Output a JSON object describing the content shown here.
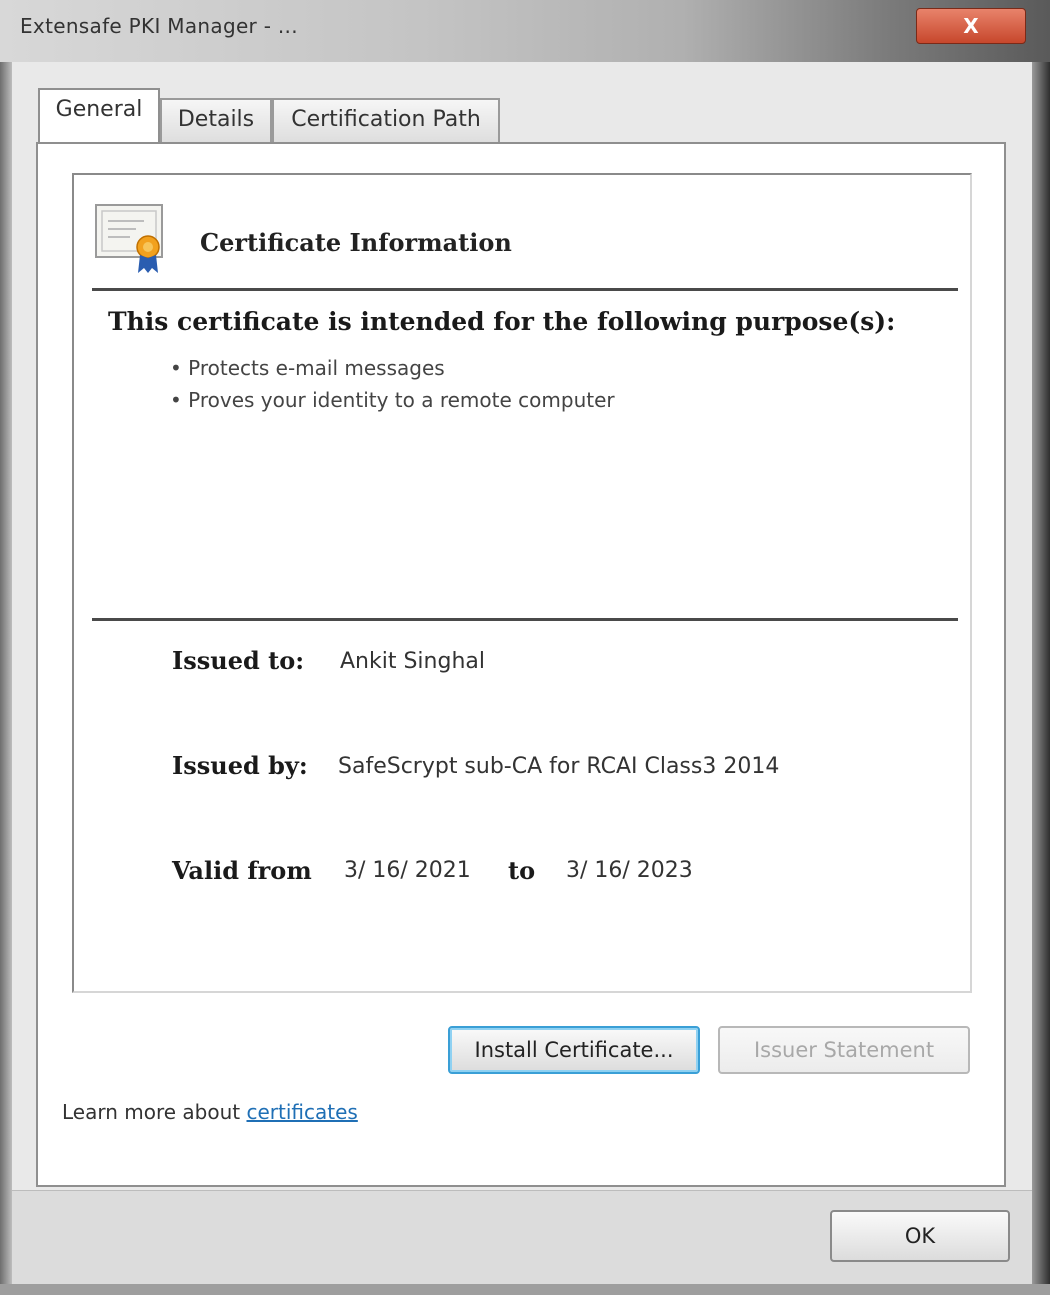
{
  "window": {
    "title": "Extensafe PKI Manager - ...",
    "close_label": "X"
  },
  "tabs": [
    {
      "label": "General",
      "active": true
    },
    {
      "label": "Details",
      "active": false
    },
    {
      "label": "Certification Path",
      "active": false
    }
  ],
  "certificate": {
    "info_title": "Certificate Information",
    "icon": "certificate-icon",
    "purpose_heading": "This certificate is intended for the following purpose(s):",
    "purposes": [
      "• Protects e-mail messages",
      "• Proves your identity to a remote computer"
    ],
    "issued_to_label": "Issued to:",
    "issued_to_value": "Ankit Singhal",
    "issued_by_label": "Issued by:",
    "issued_by_value": "SafeScrypt sub-CA for RCAI Class3 2014",
    "valid_from_label": "Valid from",
    "valid_from_value": "3/ 16/ 2021",
    "valid_to_label": "to",
    "valid_to_value": "3/ 16/ 2023"
  },
  "buttons": {
    "install_label": "Install Certificate...",
    "issuer_statement_label": "Issuer Statement",
    "ok_label": "OK"
  },
  "learn_more": {
    "prefix": "Learn more about ",
    "link": "certificates"
  },
  "colors": {
    "close_button": "#c7472c",
    "link": "#1f6fb5",
    "focus_ring": "#3a9fd6"
  }
}
